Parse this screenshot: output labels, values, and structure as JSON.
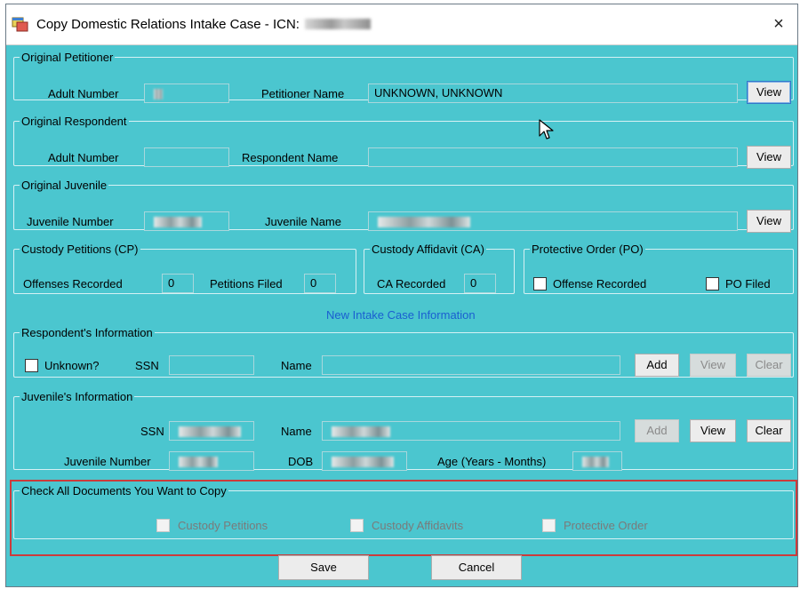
{
  "window": {
    "title": "Copy Domestic Relations Intake Case - ICN:",
    "icn_value": "",
    "close_glyph": "×",
    "icons": {
      "app": "app-window-icon",
      "close": "close-icon",
      "cursor": "mouse-pointer-icon"
    }
  },
  "original_petitioner": {
    "legend": "Original Petitioner",
    "adult_number_label": "Adult Number",
    "petitioner_name_label": "Petitioner Name",
    "petitioner_name_value": "UNKNOWN, UNKNOWN",
    "view_label": "View"
  },
  "original_respondent": {
    "legend": "Original Respondent",
    "adult_number_label": "Adult Number",
    "respondent_name_label": "Respondent Name",
    "view_label": "View"
  },
  "original_juvenile": {
    "legend": "Original Juvenile",
    "juvenile_number_label": "Juvenile Number",
    "juvenile_name_label": "Juvenile Name",
    "view_label": "View"
  },
  "custody_petitions": {
    "legend": "Custody Petitions (CP)",
    "offenses_recorded_label": "Offenses Recorded",
    "offenses_recorded_value": "0",
    "petitions_filed_label": "Petitions Filed",
    "petitions_filed_value": "0"
  },
  "custody_affidavit": {
    "legend": "Custody Affidavit (CA)",
    "ca_recorded_label": "CA Recorded",
    "ca_recorded_value": "0"
  },
  "protective_order": {
    "legend": "Protective Order (PO)",
    "offense_recorded_label": "Offense Recorded",
    "po_filed_label": "PO Filed"
  },
  "new_intake_title": "New Intake Case Information",
  "respondent_info": {
    "legend": "Respondent's Information",
    "unknown_label": "Unknown?",
    "ssn_label": "SSN",
    "name_label": "Name",
    "add_label": "Add",
    "view_label": "View",
    "clear_label": "Clear"
  },
  "juvenile_info": {
    "legend": "Juvenile's Information",
    "ssn_label": "SSN",
    "name_label": "Name",
    "juvenile_number_label": "Juvenile Number",
    "dob_label": "DOB",
    "age_label": "Age (Years - Months)",
    "add_label": "Add",
    "view_label": "View",
    "clear_label": "Clear"
  },
  "copy_documents": {
    "legend": "Check All Documents You Want to Copy",
    "custody_petitions_label": "Custody Petitions",
    "custody_affidavits_label": "Custody Affidavits",
    "protective_order_label": "Protective Order"
  },
  "footer": {
    "save_label": "Save",
    "cancel_label": "Cancel"
  },
  "colors": {
    "form_background": "#4bc6cf",
    "highlight_border": "#cc3b3b",
    "section_title": "#1a5fd0"
  }
}
